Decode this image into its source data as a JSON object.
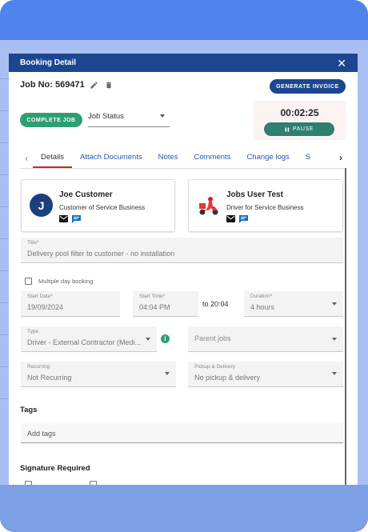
{
  "dialog": {
    "title": "Booking Detail",
    "close_glyph": "✕"
  },
  "job": {
    "number_label": "Job No: 569471",
    "generate_invoice_label": "GENERATE INVOICE",
    "complete_label": "COMPLETE JOB",
    "status_placeholder": "Job Status"
  },
  "timer": {
    "value": "00:02:25",
    "pause_label": "PAUSE"
  },
  "tabs": {
    "prev_glyph": "‹",
    "next_glyph": "›",
    "items": [
      {
        "label": "Details"
      },
      {
        "label": "Attach Documents"
      },
      {
        "label": "Notes"
      },
      {
        "label": "Comments"
      },
      {
        "label": "Change logs"
      },
      {
        "label": "S"
      }
    ]
  },
  "customer": {
    "initial": "J",
    "name": "Joe Customer",
    "subtitle": "Customer of Service Business"
  },
  "assignee": {
    "name": "Jobs User Test",
    "subtitle": "Driver for Service Business"
  },
  "form": {
    "title_label": "Title*",
    "title_value": "Delivery pool filter to customer - no installation",
    "multiple_day_label": "Multiple day booking",
    "start_date_label": "Start Date*",
    "start_date_value": "19/09/2024",
    "start_time_label": "Start Time*",
    "start_time_value": "04:04 PM",
    "to_label": "to 20:04",
    "duration_label": "Duration*",
    "duration_value": "4 hours",
    "type_label": "Type",
    "type_value": "Driver - External Contractor (Medi...",
    "parent_jobs_placeholder": "Parent jobs",
    "recurring_label": "Recurring",
    "recurring_value": "Not Recurring",
    "pickup_label": "Pickup & Delivery",
    "pickup_value": "No pickup & delivery",
    "info_glyph": "i"
  },
  "tags": {
    "section_title": "Tags",
    "placeholder": "Add tags"
  },
  "signature": {
    "section_title": "Signature Required"
  },
  "colors": {
    "header_bg": "#1d4690",
    "complete_green": "#2f9e74",
    "pause_teal": "#2d7f70",
    "active_tab_underline": "#c62828",
    "tab_link": "#2b56a8"
  }
}
